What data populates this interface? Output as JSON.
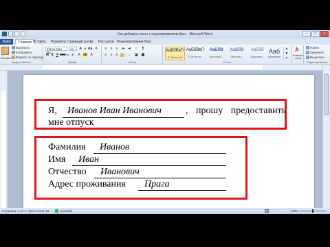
{
  "window": {
    "title": "Как добавить текст с подчеркиванием.docx - Microsoft Word"
  },
  "tabs": {
    "file": "Файл",
    "items": [
      "Главная",
      "Вставка",
      "Разметка страницы",
      "Ссылки",
      "Рассылки",
      "Рецензирование",
      "Вид"
    ]
  },
  "ribbon": {
    "clipboard": {
      "paste": "Вставить",
      "cut": "Вырезать",
      "copy": "Копировать",
      "format_painter": "Формат по образцу",
      "group": "Буфер обмена"
    },
    "font": {
      "name": "Times New Ro",
      "size": "14",
      "group": "Шрифт"
    },
    "paragraph": {
      "group": "Абзац"
    },
    "styles": {
      "items": [
        {
          "sample": "AaБбВвГг",
          "name": "¶ Обычный"
        },
        {
          "sample": "AaБбВвГг",
          "name": "¶ Без инте..."
        },
        {
          "sample": "AaБбВ",
          "name": "Заголово..."
        },
        {
          "sample": "AaБбВ",
          "name": "Заголово..."
        },
        {
          "sample": "AaБбВ",
          "name": "Заголово..."
        },
        {
          "sample": "Aaб",
          "name": "Название"
        }
      ],
      "change": "Изменить стили",
      "group": "Стили"
    },
    "editing": {
      "find": "Найти",
      "replace": "Заменить",
      "select": "Выделить",
      "group": "Редактирование"
    }
  },
  "document": {
    "line1_prefix": "Я,",
    "line1_name": "Иванов Иван Иванович",
    "line1_suffix": ", прошу предоставить",
    "line2": "мне отпуск",
    "fields": [
      {
        "label": "Фамилия",
        "value": "Иванов"
      },
      {
        "label": "Имя",
        "value": "Иван"
      },
      {
        "label": "Отчество",
        "value": "Иванович"
      },
      {
        "label": "Адрес проживания",
        "value": "Прага"
      }
    ]
  },
  "status": {
    "page": "Страница: 1 из 1",
    "words": "Число слов: 16",
    "language": "русский",
    "zoom": "100%"
  },
  "colors": {
    "highlight_box": "#e5141b",
    "file_tab": "#2a5699"
  }
}
